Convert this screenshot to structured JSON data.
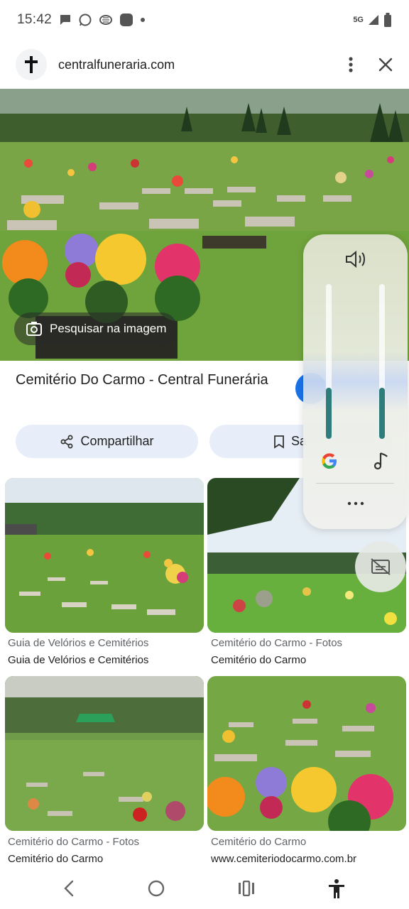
{
  "status": {
    "time": "15:42",
    "network": "5G"
  },
  "browser": {
    "url": "centralfunerariа.com",
    "menu_icon": "more-vert-icon",
    "close_icon": "close-icon",
    "site_icon": "cross-icon"
  },
  "hero": {
    "search_label": "Pesquisar na imagem"
  },
  "result": {
    "title": "Cemitério Do Carmo - Central Funerária"
  },
  "actions": {
    "share_label": "Compartilhar",
    "save_label": "Sa"
  },
  "grid": [
    {
      "source": "Guia de Velórios e Cemitérios",
      "title": "Guia de Velórios e Cemitérios"
    },
    {
      "source": "Cemitério do Carmo - Fotos",
      "title": "Cemitério do Carmo"
    },
    {
      "source": "Cemitério do Carmo - Fotos",
      "title": "Cemitério do Carmo"
    },
    {
      "source": "Cemitério do Carmo",
      "title": "www.cemiteriodocarmo.com.br"
    }
  ],
  "volume": {
    "ringtone_level": 0.33,
    "media_level": 0.33,
    "more_label": "..."
  },
  "colors": {
    "accent": "#1a73e8",
    "pill_bg": "#e8eef9",
    "slider_fill": "#2e7d7a"
  }
}
